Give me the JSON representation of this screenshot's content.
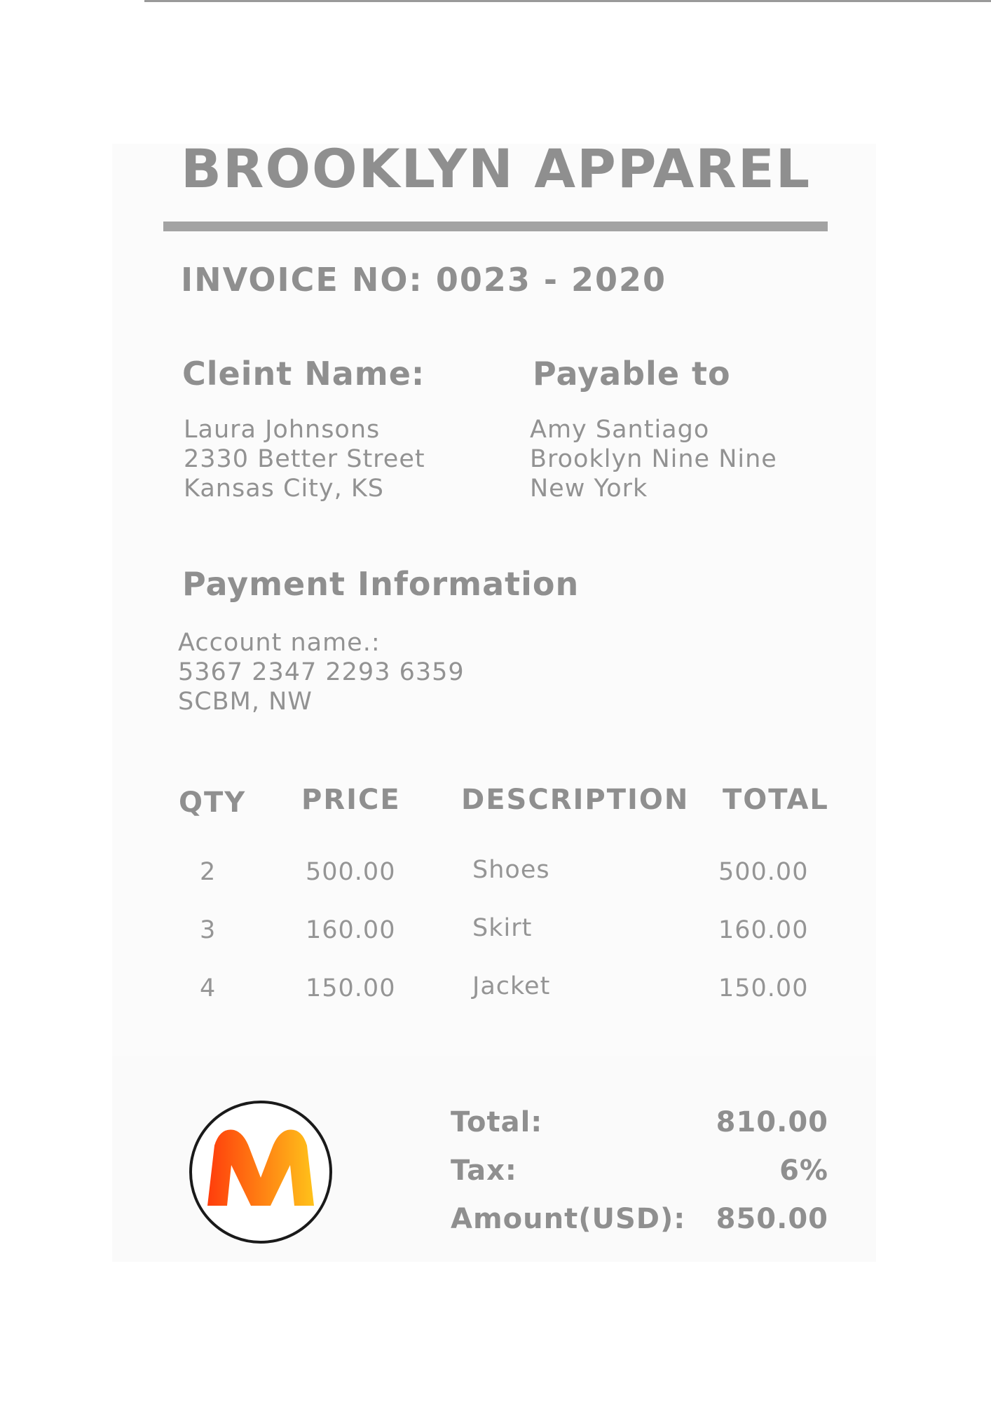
{
  "invoice": {
    "company_name": "BROOKLYN APPAREL",
    "invoice_number": "INVOICE NO: 0023 - 2020",
    "client": {
      "heading": "Cleint Name:",
      "lines": [
        "Laura Johnsons",
        "2330 Better Street",
        "Kansas City, KS"
      ]
    },
    "payable": {
      "heading": "Payable to",
      "lines": [
        "Amy Santiago",
        "Brooklyn Nine Nine",
        "New York"
      ]
    },
    "payment": {
      "heading": "Payment Information",
      "lines": [
        "Account name.:",
        "5367 2347 2293 6359",
        "SCBM, NW"
      ]
    },
    "table": {
      "headers": {
        "qty": "QTY",
        "price": "PRICE",
        "description": "DESCRIPTION",
        "total": "TOTAL"
      },
      "rows": [
        {
          "qty": "2",
          "price": "500.00",
          "description": "Shoes",
          "total": "500.00"
        },
        {
          "qty": "3",
          "price": "160.00",
          "description": "Skirt",
          "total": "160.00"
        },
        {
          "qty": "4",
          "price": "150.00",
          "description": "Jacket",
          "total": "150.00"
        }
      ]
    },
    "summary": {
      "total_label": "Total:",
      "total_value": "810.00",
      "tax_label": "Tax:",
      "tax_value": "6%",
      "amount_label": "Amount(USD):",
      "amount_value": "850.00"
    },
    "logo": {
      "letter": "M",
      "icon": "m-logo-icon",
      "colors": {
        "gradient_start": "#ff3d0c",
        "gradient_end": "#ffc21a",
        "ring": "#1a1a1a"
      }
    }
  }
}
